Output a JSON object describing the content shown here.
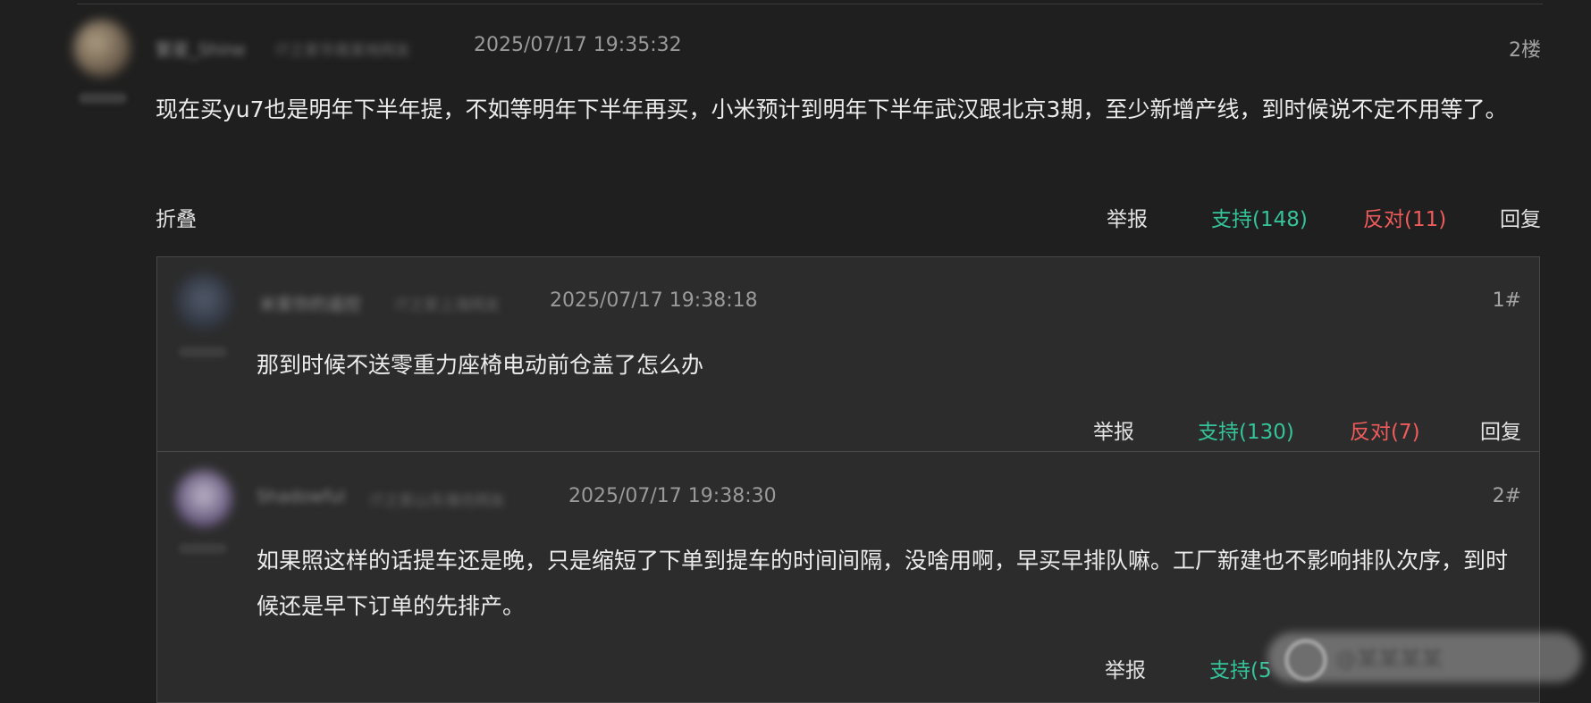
{
  "colors": {
    "background": "#1f1f1f",
    "reply_box": "#2c2c2c",
    "support": "#35c39a",
    "oppose": "#f05c5c"
  },
  "post": {
    "username": "繁星_Shine",
    "source": "IT之家华南某地网友",
    "time": "2025/07/17 19:35:32",
    "floor": "2楼",
    "content": "现在买yu7也是明年下半年提，不如等明年下半年再买，小米预计到明年下半年武汉跟北京3期，至少新增产线，到时候说不定不用等了。",
    "actions": {
      "fold": "折叠",
      "report": "举报",
      "support": "支持(148)",
      "oppose": "反对(11)",
      "reply": "回复"
    }
  },
  "replies": [
    {
      "username": "米家你的遥控",
      "source": "IT之家上海网友",
      "time": "2025/07/17 19:38:18",
      "floor": "1#",
      "content": "那到时候不送零重力座椅电动前仓盖了怎么办",
      "actions": {
        "report": "举报",
        "support": "支持(130)",
        "oppose": "反对(7)",
        "reply": "回复"
      }
    },
    {
      "username": "Shadowful",
      "source": "IT之家山东潍坊网友",
      "time": "2025/07/17 19:38:30",
      "floor": "2#",
      "content": "如果照这样的话提车还是晚，只是缩短了下单到提车的时间间隔，没啥用啊，早买早排队嘛。工厂新建也不影响排队次序，到时候还是早下订单的先排产。",
      "actions": {
        "report": "举报",
        "support": "支持(5"
      }
    }
  ],
  "watermark": {
    "icon": "weibo-logo-icon",
    "text": "@某某某某"
  }
}
